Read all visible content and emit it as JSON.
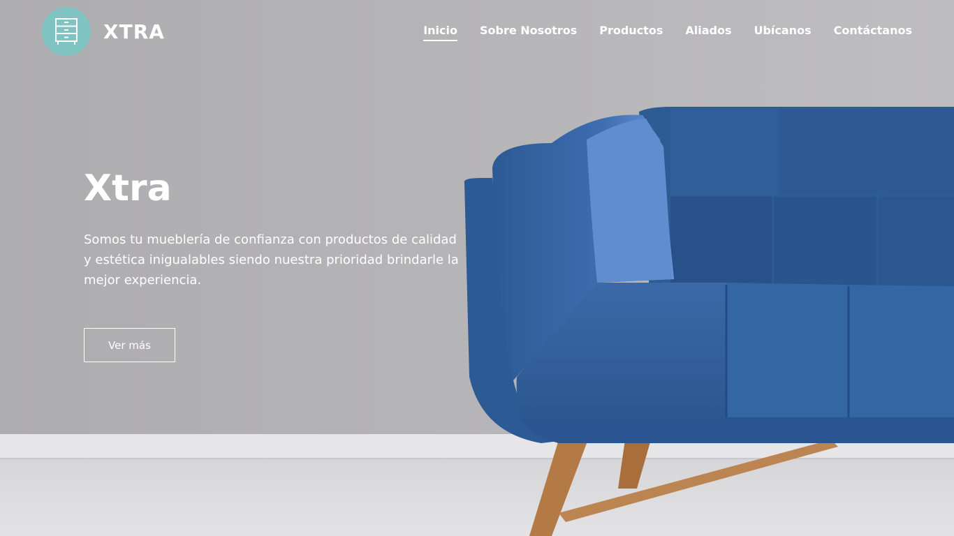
{
  "brand": {
    "name": "XTRA",
    "logo_icon": "dresser-icon",
    "logo_color": "#7fc4c3"
  },
  "nav": {
    "items": [
      {
        "label": "Inicio",
        "active": true
      },
      {
        "label": "Sobre Nosotros",
        "active": false
      },
      {
        "label": "Productos",
        "active": false
      },
      {
        "label": "Aliados",
        "active": false
      },
      {
        "label": "Ubícanos",
        "active": false
      },
      {
        "label": "Contáctanos",
        "active": false
      }
    ]
  },
  "hero": {
    "title": "Xtra",
    "description": "Somos tu mueblería de confianza con productos de calidad y estética inigualables siendo nuestra prioridad brindarle la mejor experiencia.",
    "button_label": "Ver más",
    "image_subject": "blue-velvet-sofa"
  },
  "colors": {
    "wall": "#b4b3b6",
    "floor": "#dcdcdf",
    "sofa_blue": "#2f5d96",
    "sofa_light": "#5f8bcb",
    "legs": "#b57d4a"
  }
}
